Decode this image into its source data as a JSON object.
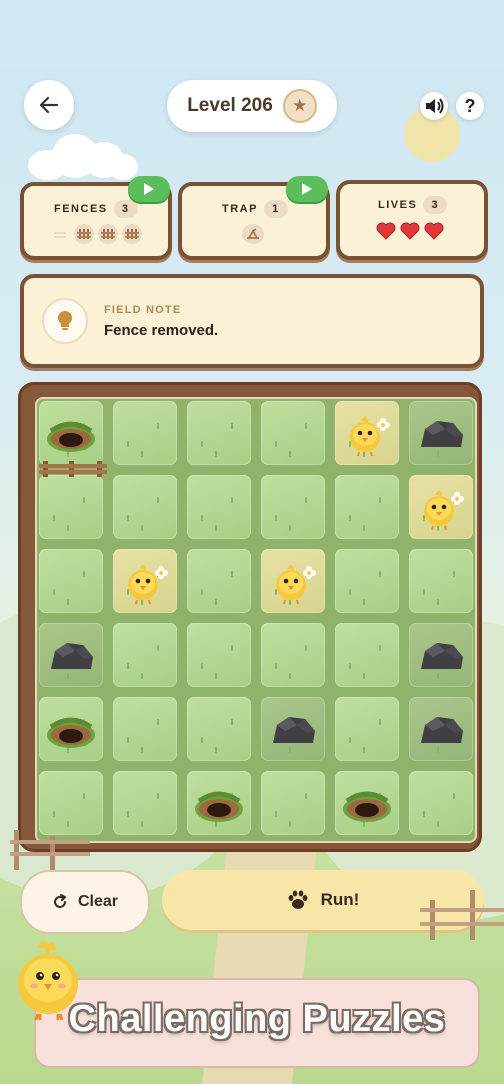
{
  "header": {
    "level_text": "Level 206",
    "back_icon": "arrow-left-icon",
    "star_icon": "star-icon",
    "sound_icon": "speaker-icon",
    "help_label": "?"
  },
  "stats": {
    "fences": {
      "label": "FENCES",
      "count": "3"
    },
    "trap": {
      "label": "TRAP",
      "count": "1"
    },
    "lives": {
      "label": "LIVES",
      "count": "3",
      "hearts": 3
    }
  },
  "note": {
    "label": "FIELD NOTE",
    "text": "Fence removed.",
    "icon": "lightbulb-icon"
  },
  "board": {
    "rows": 6,
    "cols": 6,
    "cells": [
      [
        "burrow",
        "grass",
        "grass",
        "grass",
        "chick",
        "rock"
      ],
      [
        "grass",
        "grass",
        "grass",
        "grass",
        "grass",
        "chick"
      ],
      [
        "grass",
        "chick",
        "grass",
        "chick",
        "grass",
        "grass"
      ],
      [
        "rock",
        "grass",
        "grass",
        "grass",
        "grass",
        "rock"
      ],
      [
        "burrow",
        "grass",
        "grass",
        "rock",
        "grass",
        "rock"
      ],
      [
        "grass",
        "grass",
        "burrow",
        "grass",
        "burrow",
        "grass"
      ]
    ]
  },
  "actions": {
    "clear_label": "Clear",
    "run_label": "Run!",
    "clear_icon": "refresh-icon",
    "run_icon": "paw-icon"
  },
  "banner": {
    "text": "Challenging Puzzles"
  },
  "colors": {
    "card_border": "#7b5134",
    "card_bg": "#fbf1d6",
    "play_green": "#5cbe5a",
    "board_wood": "#86583a",
    "run_button": "#f8e5a8"
  }
}
